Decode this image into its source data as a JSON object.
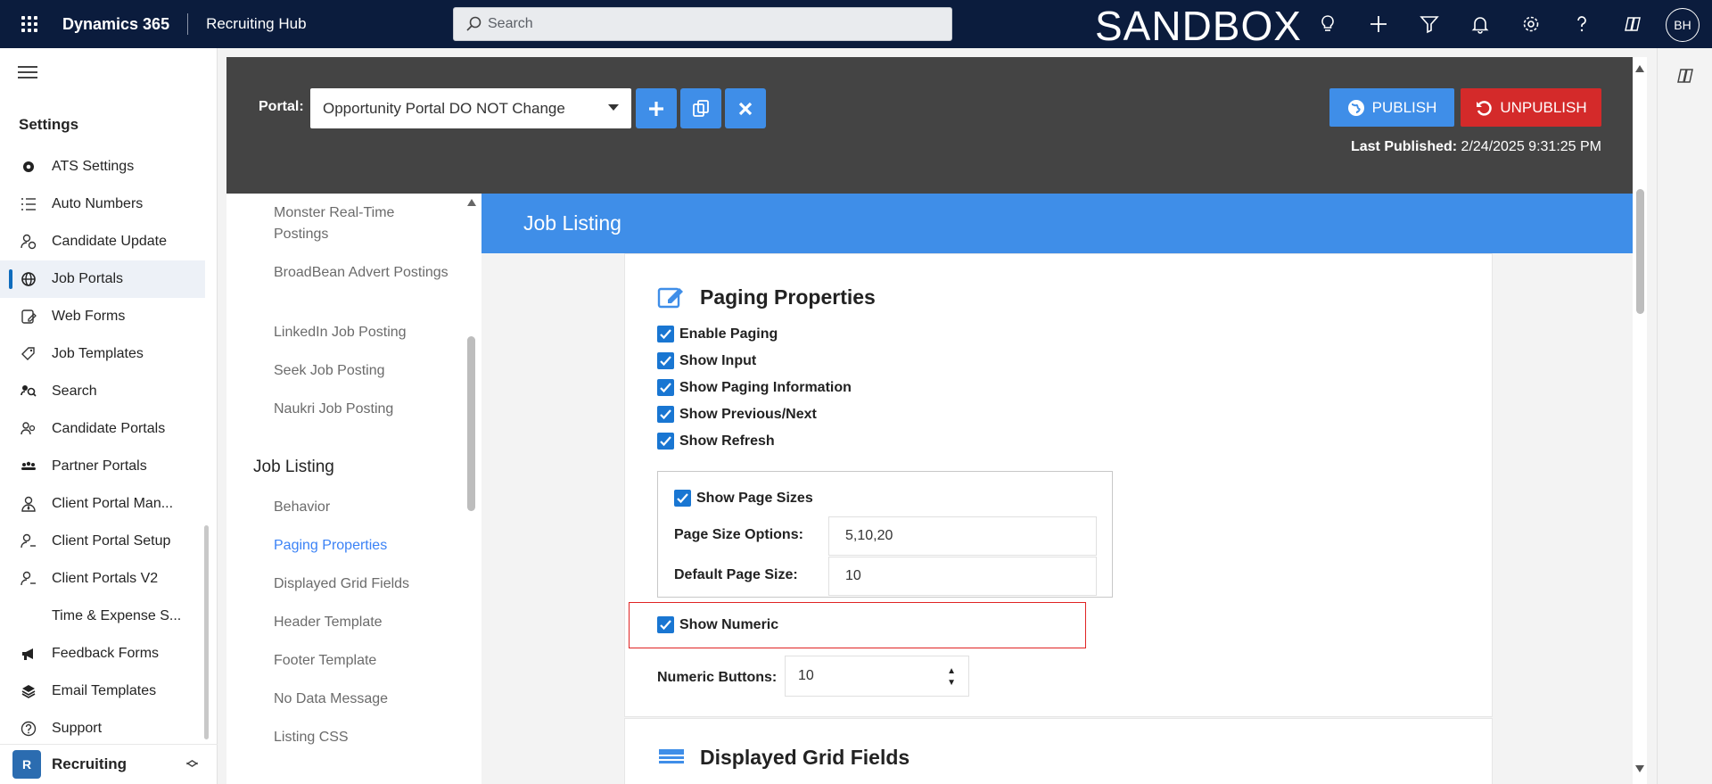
{
  "topbar": {
    "app_name": "Dynamics 365",
    "hub_name": "Recruiting Hub",
    "search_placeholder": "Search",
    "environment_label": "SANDBOX",
    "avatar_initials": "BH",
    "icons": [
      "lightbulb-icon",
      "plus-icon",
      "filter-icon",
      "bell-icon",
      "gear-icon",
      "help-icon",
      "copilot-icon"
    ]
  },
  "leftnav": {
    "heading": "Settings",
    "items": [
      {
        "label": "ATS Settings",
        "icon": "gear-icon"
      },
      {
        "label": "Auto Numbers",
        "icon": "numbered-list-icon"
      },
      {
        "label": "Candidate Update",
        "icon": "person-sync-icon"
      },
      {
        "label": "Job Portals",
        "icon": "globe-icon",
        "active": true
      },
      {
        "label": "Web Forms",
        "icon": "form-edit-icon"
      },
      {
        "label": "Job Templates",
        "icon": "template-icon"
      },
      {
        "label": "Search",
        "icon": "search-people-icon"
      },
      {
        "label": "Candidate Portals",
        "icon": "people-icon"
      },
      {
        "label": "Partner Portals",
        "icon": "group-icon"
      },
      {
        "label": "Client Portal Man...",
        "icon": "person-tie-icon"
      },
      {
        "label": "Client Portal Setup",
        "icon": "person-setup-icon"
      },
      {
        "label": "Client Portals V2",
        "icon": "person-v2-icon"
      },
      {
        "label": "Time & Expense S...",
        "icon": ""
      },
      {
        "label": "Feedback Forms",
        "icon": "megaphone-icon"
      },
      {
        "label": "Email Templates",
        "icon": "layers-icon"
      },
      {
        "label": "Support",
        "icon": "question-icon"
      }
    ],
    "area": {
      "badge": "R",
      "label": "Recruiting"
    }
  },
  "portal": {
    "label": "Portal:",
    "selected": "Opportunity Portal DO NOT Change",
    "publish_label": "PUBLISH",
    "unpublish_label": "UNPUBLISH",
    "last_published_label": "Last Published:",
    "last_published_value": "2/24/2025 9:31:25 PM"
  },
  "tree": {
    "items_top": [
      "Monster Real-Time Postings",
      "BroadBean Advert Postings",
      "LinkedIn Job Posting",
      "Seek Job Posting",
      "Naukri Job Posting"
    ],
    "group_heading": "Job Listing",
    "items_group": [
      "Behavior",
      "Paging Properties",
      "Displayed Grid Fields",
      "Header Template",
      "Footer Template",
      "No Data Message",
      "Listing CSS"
    ],
    "selected": "Paging Properties"
  },
  "content": {
    "header": "Job Listing",
    "section_title": "Paging Properties",
    "checkboxes": [
      "Enable Paging",
      "Show Input",
      "Show Paging Information",
      "Show Previous/Next",
      "Show Refresh"
    ],
    "page_sizes": {
      "checkbox_label": "Show Page Sizes",
      "options_label": "Page Size Options:",
      "options_value": "5,10,20",
      "default_label": "Default Page Size:",
      "default_value": "10"
    },
    "show_numeric_label": "Show Numeric",
    "numeric_buttons_label": "Numeric Buttons:",
    "numeric_buttons_value": "10",
    "next_section_title": "Displayed Grid Fields"
  },
  "colors": {
    "topbar_bg": "#0b1c3d",
    "accent_blue": "#3f8ee8",
    "unpublish_red": "#d42a2a",
    "portal_bar_bg": "#444444",
    "highlight_border": "#e02424"
  }
}
